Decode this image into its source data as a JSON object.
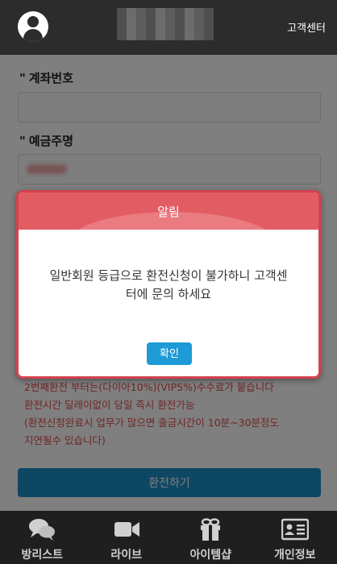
{
  "header": {
    "support_label": "고객센터"
  },
  "form": {
    "account_number_label": "계좌번호",
    "account_holder_label": "예금주명",
    "required_mark": "\""
  },
  "notice": {
    "line1": "2번째환전 부터는(다이아10%)(VIP5%)수수료가 붙습니다",
    "line2": "환전시간 딜레이없이 당일 즉시 환전가능",
    "line3": "(환전신청완료시 업무가 많으면 출금시간이 10분~30분정도",
    "line4": "지연될수 있습니다)"
  },
  "submit_label": "환전하기",
  "modal": {
    "title": "알림",
    "message_line1": "일반회원 등급으로 환전신청이 불가하니    고객센",
    "message_line2": "터에 문의 하세요",
    "confirm_label": "확인"
  },
  "bottom_nav": [
    {
      "label": "방리스트",
      "icon": "chat-bubbles-icon"
    },
    {
      "label": "라이브",
      "icon": "video-camera-icon"
    },
    {
      "label": "아이템샵",
      "icon": "gift-icon"
    },
    {
      "label": "개인정보",
      "icon": "id-card-icon"
    }
  ],
  "colors": {
    "header_bg": "#2c2c2c",
    "modal_header": "#e25d63",
    "modal_border": "#d4424e",
    "button_blue": "#1d9bd6",
    "notice_red": "#e04a4a"
  }
}
